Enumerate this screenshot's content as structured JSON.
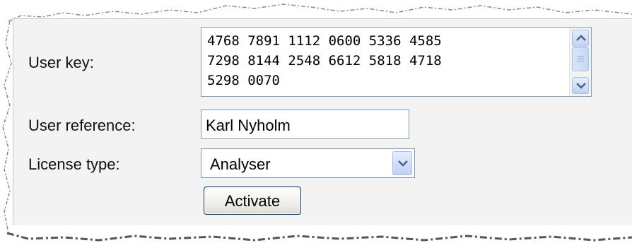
{
  "form": {
    "user_key_label": "User key:",
    "user_key_value": "4768 7891 1112 0600 5336 4585\n7298 8144 2548 6612 5818 4718\n5298 0070",
    "user_reference_label": "User reference:",
    "user_reference_value": "Karl Nyholm",
    "license_type_label": "License type:",
    "license_type_selected": "Analyser",
    "activate_button_label": "Activate"
  },
  "icons": {
    "scroll_up": "scroll-up-arrow-icon",
    "scroll_down": "scroll-down-arrow-icon",
    "dropdown": "chevron-down-icon"
  },
  "colors": {
    "panel_background": "#f3f3f3",
    "input_border": "#7f9db9",
    "button_border": "#003c74",
    "scroll_button": "#bfd1f6"
  }
}
